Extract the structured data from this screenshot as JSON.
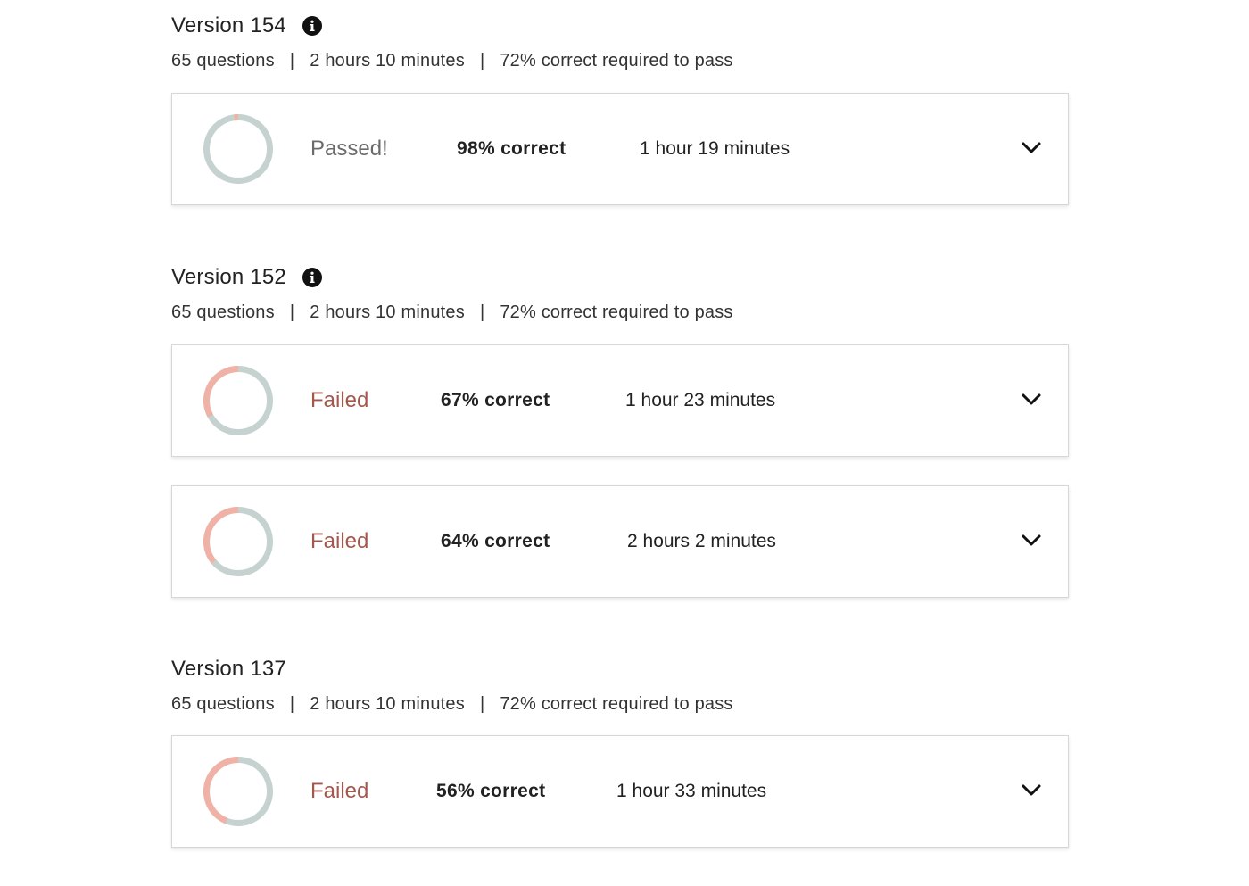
{
  "colors": {
    "ring_track": "#c6d2cf",
    "ring_wrong": "#f0b2a6",
    "failed_text": "#a4574d",
    "passed_text": "#6b6b6b"
  },
  "versions": [
    {
      "title": "Version 154",
      "has_info": true,
      "meta": {
        "questions": "65 questions",
        "time_limit": "2 hours 10 minutes",
        "pass_requirement": "72% correct required to pass"
      },
      "attempts": [
        {
          "status": "Passed!",
          "score": "98% correct",
          "duration": "1 hour 19 minutes",
          "correct_fraction": 0.98,
          "icon": "chevron-down-icon"
        }
      ]
    },
    {
      "title": "Version 152",
      "has_info": true,
      "meta": {
        "questions": "65 questions",
        "time_limit": "2 hours 10 minutes",
        "pass_requirement": "72% correct required to pass"
      },
      "attempts": [
        {
          "status": "Failed",
          "score": "67% correct",
          "duration": "1 hour 23 minutes",
          "correct_fraction": 0.67,
          "icon": "chevron-down-icon"
        },
        {
          "status": "Failed",
          "score": "64% correct",
          "duration": "2 hours 2 minutes",
          "correct_fraction": 0.64,
          "icon": "chevron-down-icon"
        }
      ]
    },
    {
      "title": "Version 137",
      "has_info": false,
      "meta": {
        "questions": "65 questions",
        "time_limit": "2 hours 10 minutes",
        "pass_requirement": "72% correct required to pass"
      },
      "attempts": [
        {
          "status": "Failed",
          "score": "56% correct",
          "duration": "1 hour 33 minutes",
          "correct_fraction": 0.56,
          "icon": "chevron-down-icon"
        }
      ]
    }
  ]
}
